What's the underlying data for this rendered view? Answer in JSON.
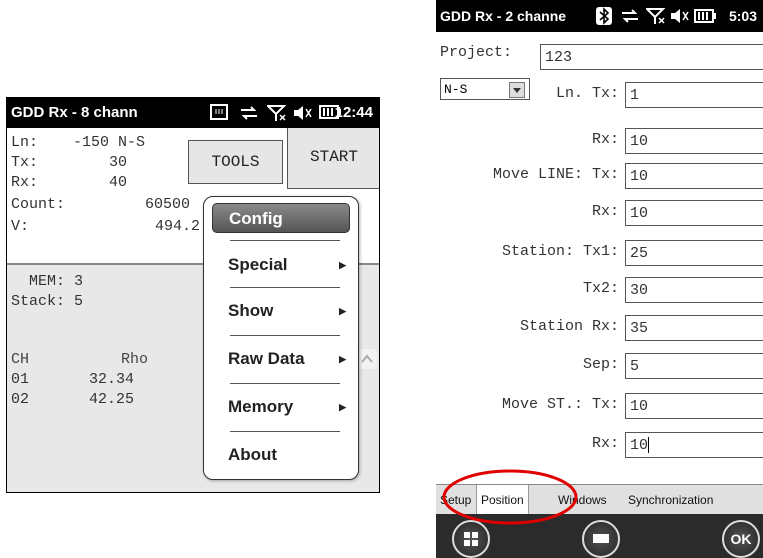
{
  "left": {
    "title": "GDD Rx - 8 chann",
    "clock": "12:44",
    "readouts": [
      {
        "label": "Ln:",
        "value": "-150 N-S"
      },
      {
        "label": "Tx:",
        "value": "30"
      },
      {
        "label": "Rx:",
        "value": "40"
      },
      {
        "label": "Count:",
        "value": "60500"
      },
      {
        "label": "V:",
        "value": "494.2"
      }
    ],
    "tools_label": "TOOLS",
    "start_label": "START",
    "mem_label": "MEM: 3",
    "stack_label": "Stack: 5",
    "table": {
      "headers": [
        "CH",
        "Rho"
      ],
      "rows": [
        [
          "01",
          "32.34"
        ],
        [
          "02",
          "42.25"
        ]
      ]
    },
    "menu": [
      "Config",
      "Special",
      "Show",
      "Raw Data",
      "Memory",
      "About"
    ]
  },
  "right": {
    "title": "GDD Rx - 2 channe",
    "clock": "5:03",
    "project_label": "Project:",
    "project_value": "123",
    "direction_value": "N-S",
    "fields": [
      {
        "label": "Ln. Tx:",
        "value": "1"
      },
      {
        "label": "Rx:",
        "value": "10"
      },
      {
        "label": "Move LINE: Tx:",
        "value": "10"
      },
      {
        "label": "Rx:",
        "value": "10"
      },
      {
        "label": "Station: Tx1:",
        "value": "25"
      },
      {
        "label": "Tx2:",
        "value": "30"
      },
      {
        "label": "Station Rx:",
        "value": "35"
      },
      {
        "label": "Sep:",
        "value": "5"
      },
      {
        "label": "Move ST.: Tx:",
        "value": "10"
      },
      {
        "label": "Rx:",
        "value": "10"
      }
    ],
    "tabs": [
      "Setup",
      "Position",
      "Windows",
      "Synchronization"
    ],
    "ok_label": "OK"
  },
  "colors": {
    "highlight_ring": "#e00000",
    "titlebar": "#000000"
  }
}
